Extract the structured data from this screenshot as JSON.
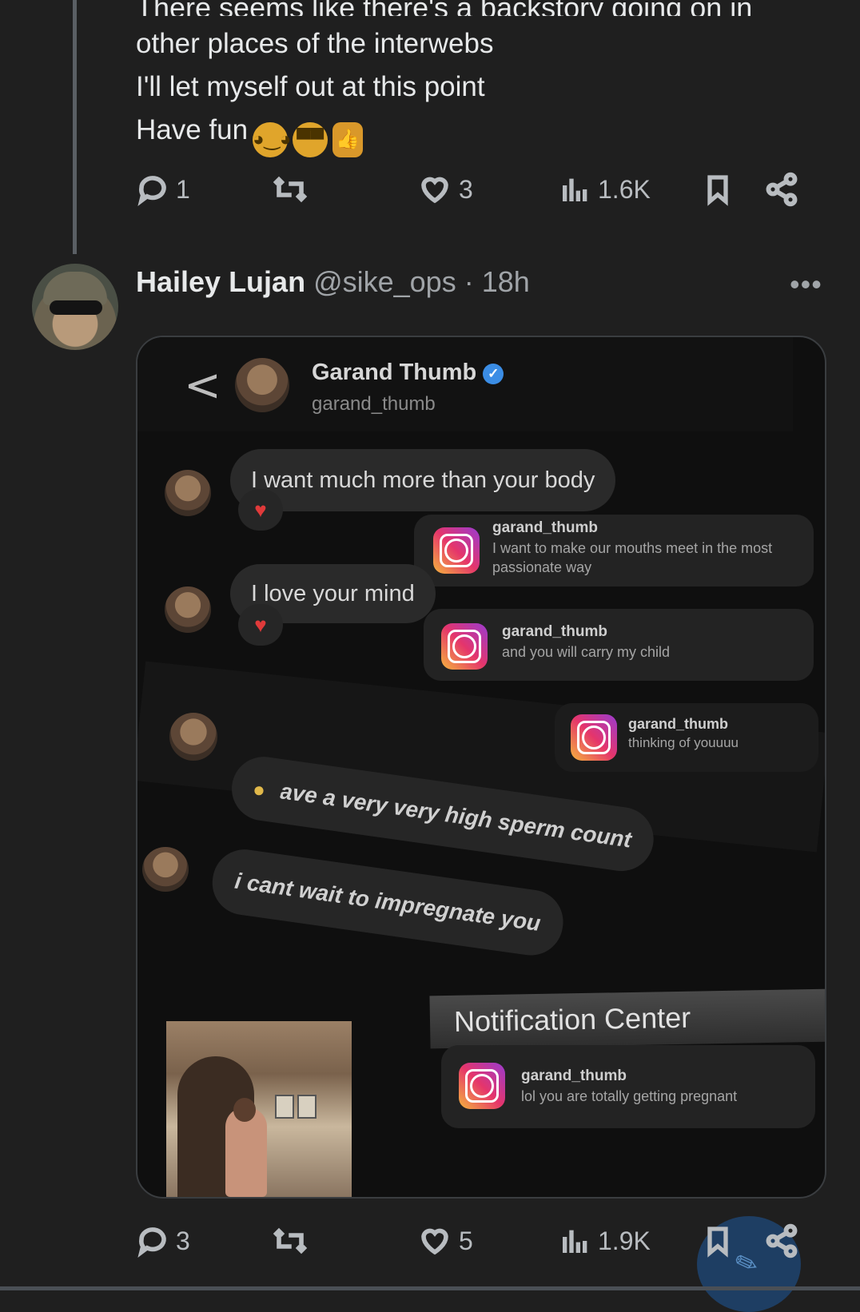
{
  "thread": {
    "cut_line": "There seems like there's a backstory going on in",
    "lines": [
      "other places of the interwebs",
      "I'll let myself out at this point",
      "Have fun"
    ],
    "emojis": [
      "wink-face-emoji",
      "sunglasses-face-emoji",
      "thumbs-up-emoji"
    ],
    "stats": {
      "replies": "1",
      "likes": "3",
      "views": "1.6K"
    }
  },
  "tweet": {
    "name": "Hailey Lujan",
    "handle": "@sike_ops",
    "separator": "·",
    "time": "18h",
    "more": "•••",
    "stats": {
      "replies": "3",
      "likes": "5",
      "views": "1.9K"
    }
  },
  "screenshot": {
    "back_glyph": "<",
    "display_name": "Garand Thumb",
    "username": "garand_thumb",
    "bubbles": [
      "I want much more than your body",
      "I love your mind"
    ],
    "tilted_bubbles": [
      "i have a very very high sperm count",
      "i cant wait to impregnate you"
    ],
    "notifications": [
      {
        "user": "garand_thumb",
        "message": "I want to make our mouths meet in the most passionate way"
      },
      {
        "user": "garand_thumb",
        "message": "and you will carry my child"
      },
      {
        "user": "garand_thumb",
        "message": "thinking of youuuu"
      },
      {
        "user": "garand_thumb",
        "message": "lol you are totally getting pregnant"
      }
    ],
    "notification_center": "Notification Center"
  },
  "colors": {
    "background": "#1f1f1f",
    "text": "#e7e9ea",
    "muted": "#a0a4a8",
    "verified": "#3b8de5",
    "heart": "#e03a3a"
  }
}
